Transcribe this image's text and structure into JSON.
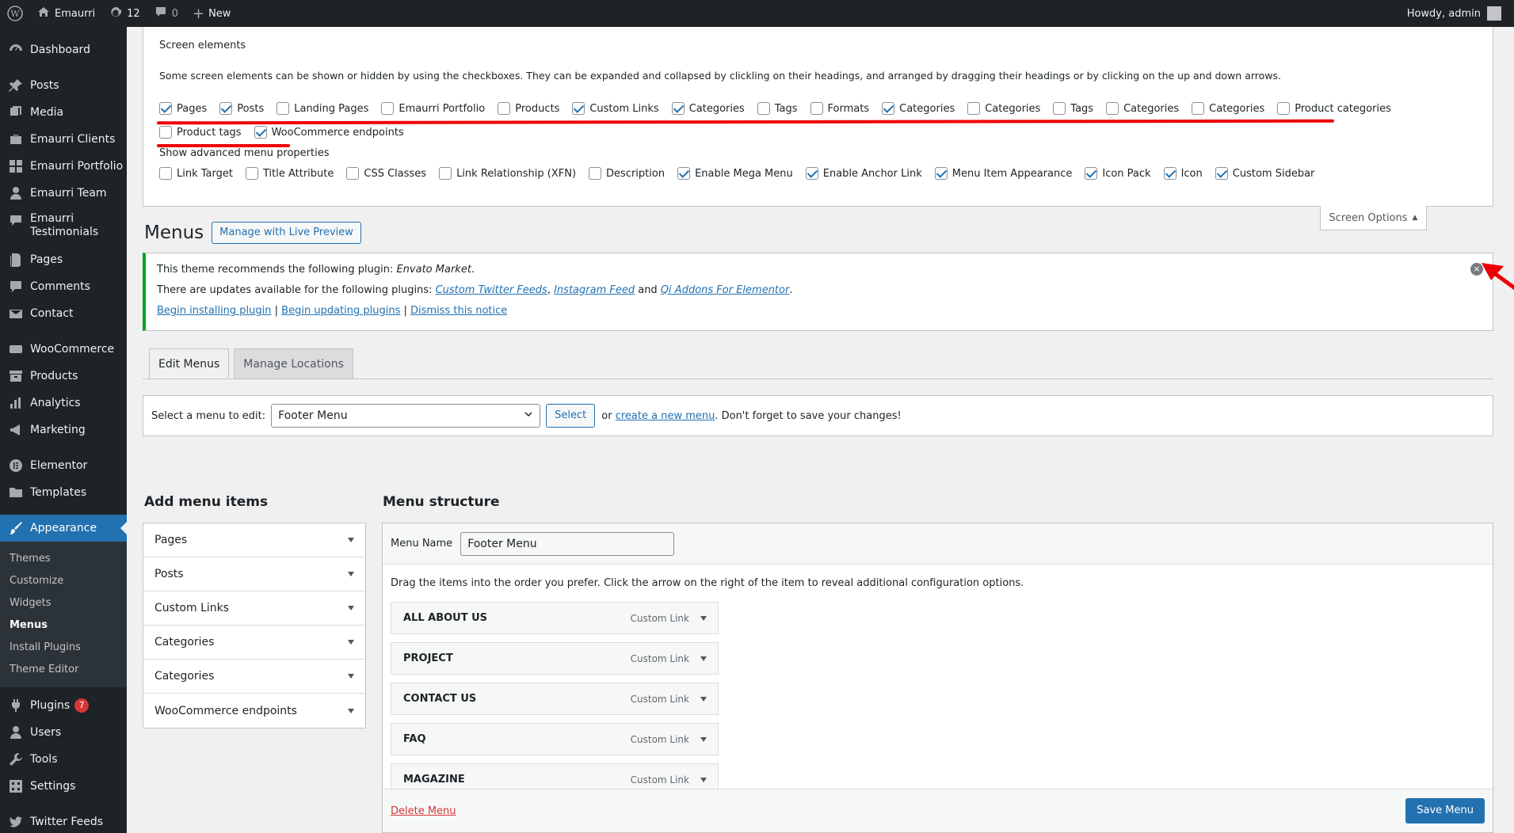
{
  "adminbar": {
    "site_name": "Emaurri",
    "updates_count": "12",
    "comments_count": "0",
    "new_label": "New",
    "howdy": "Howdy, admin"
  },
  "sidebar": {
    "items": [
      {
        "label": "Dashboard",
        "icon": "dashboard-icon"
      },
      {
        "label": "Posts",
        "icon": "pin-icon"
      },
      {
        "label": "Media",
        "icon": "media-icon"
      },
      {
        "label": "Emaurri Clients",
        "icon": "briefcase-icon"
      },
      {
        "label": "Emaurri Portfolio",
        "icon": "grid-icon"
      },
      {
        "label": "Emaurri Team",
        "icon": "person-icon"
      },
      {
        "label": "Emaurri Testimonials",
        "icon": "quote-icon"
      },
      {
        "label": "Pages",
        "icon": "pages-icon"
      },
      {
        "label": "Comments",
        "icon": "comment-icon"
      },
      {
        "label": "Contact",
        "icon": "mail-icon"
      },
      {
        "label": "WooCommerce",
        "icon": "woo-icon"
      },
      {
        "label": "Products",
        "icon": "archive-icon"
      },
      {
        "label": "Analytics",
        "icon": "chart-icon"
      },
      {
        "label": "Marketing",
        "icon": "megaphone-icon"
      },
      {
        "label": "Elementor",
        "icon": "elementor-icon"
      },
      {
        "label": "Templates",
        "icon": "folder-icon"
      },
      {
        "label": "Appearance",
        "icon": "brush-icon"
      },
      {
        "label": "Plugins",
        "icon": "plug-icon",
        "badge": "7"
      },
      {
        "label": "Users",
        "icon": "users-icon"
      },
      {
        "label": "Tools",
        "icon": "wrench-icon"
      },
      {
        "label": "Settings",
        "icon": "settings-icon"
      },
      {
        "label": "Twitter Feeds",
        "icon": "twitter-icon"
      }
    ],
    "submenu": [
      "Themes",
      "Customize",
      "Widgets",
      "Menus",
      "Install Plugins",
      "Theme Editor"
    ]
  },
  "screen_options": {
    "title": "Screen elements",
    "description": "Some screen elements can be shown or hidden by using the checkboxes. They can be expanded and collapsed by clickling on their headings, and arranged by dragging their headings or by clicking on the up and down arrows.",
    "boxes": [
      {
        "label": "Pages",
        "checked": true
      },
      {
        "label": "Posts",
        "checked": true
      },
      {
        "label": "Landing Pages",
        "checked": false
      },
      {
        "label": "Emaurri Portfolio",
        "checked": false
      },
      {
        "label": "Products",
        "checked": false
      },
      {
        "label": "Custom Links",
        "checked": true
      },
      {
        "label": "Categories",
        "checked": true
      },
      {
        "label": "Tags",
        "checked": false
      },
      {
        "label": "Formats",
        "checked": false
      },
      {
        "label": "Categories",
        "checked": true
      },
      {
        "label": "Categories",
        "checked": false
      },
      {
        "label": "Tags",
        "checked": false
      },
      {
        "label": "Categories",
        "checked": false
      },
      {
        "label": "Categories",
        "checked": false
      },
      {
        "label": "Product categories",
        "checked": false
      },
      {
        "label": "Product tags",
        "checked": false
      },
      {
        "label": "WooCommerce endpoints",
        "checked": true
      }
    ],
    "advanced_title": "Show advanced menu properties",
    "advanced": [
      {
        "label": "Link Target",
        "checked": false
      },
      {
        "label": "Title Attribute",
        "checked": false
      },
      {
        "label": "CSS Classes",
        "checked": false
      },
      {
        "label": "Link Relationship (XFN)",
        "checked": false
      },
      {
        "label": "Description",
        "checked": false
      },
      {
        "label": "Enable Mega Menu",
        "checked": true
      },
      {
        "label": "Enable Anchor Link",
        "checked": true
      },
      {
        "label": "Menu Item Appearance",
        "checked": true
      },
      {
        "label": "Icon Pack",
        "checked": true
      },
      {
        "label": "Icon",
        "checked": true
      },
      {
        "label": "Custom Sidebar",
        "checked": true
      }
    ],
    "tab_label": "Screen Options"
  },
  "page": {
    "title": "Menus",
    "live_preview": "Manage with Live Preview"
  },
  "notice": {
    "line1_prefix": "This theme recommends the following plugin: ",
    "line1_plugin": "Envato Market",
    "line1_suffix": ".",
    "line2_prefix": "There are updates available for the following plugins: ",
    "plugin_a": "Custom Twitter Feeds",
    "sep_comma": ", ",
    "plugin_b": "Instagram Feed",
    "sep_and": " and ",
    "plugin_c": "Qi Addons For Elementor",
    "line2_suffix": ".",
    "link_install": "Begin installing plugin",
    "link_update": "Begin updating plugins",
    "link_dismiss": "Dismiss this notice",
    "pipe": " | "
  },
  "tabs": {
    "edit": "Edit Menus",
    "locations": "Manage Locations"
  },
  "manage": {
    "label": "Select a menu to edit:",
    "selected": "Footer Menu",
    "select_btn": "Select",
    "or": "or",
    "create_link": "create a new menu",
    "suffix": ". Don't forget to save your changes!"
  },
  "add_items": {
    "title": "Add menu items",
    "sections": [
      "Pages",
      "Posts",
      "Custom Links",
      "Categories",
      "Categories",
      "WooCommerce endpoints"
    ]
  },
  "structure": {
    "title": "Menu structure",
    "name_label": "Menu Name",
    "name_value": "Footer Menu",
    "instructions": "Drag the items into the order you prefer. Click the arrow on the right of the item to reveal additional configuration options.",
    "items": [
      {
        "label": "ALL ABOUT US",
        "type": "Custom Link"
      },
      {
        "label": "PROJECT",
        "type": "Custom Link"
      },
      {
        "label": "CONTACT US",
        "type": "Custom Link"
      },
      {
        "label": "FAQ",
        "type": "Custom Link"
      },
      {
        "label": "MAGAZINE",
        "type": "Custom Link"
      }
    ],
    "delete": "Delete Menu",
    "save": "Save Menu"
  },
  "colors": {
    "accent": "#2271b1",
    "annotation": "#e00000",
    "notice": "#00a32a"
  }
}
